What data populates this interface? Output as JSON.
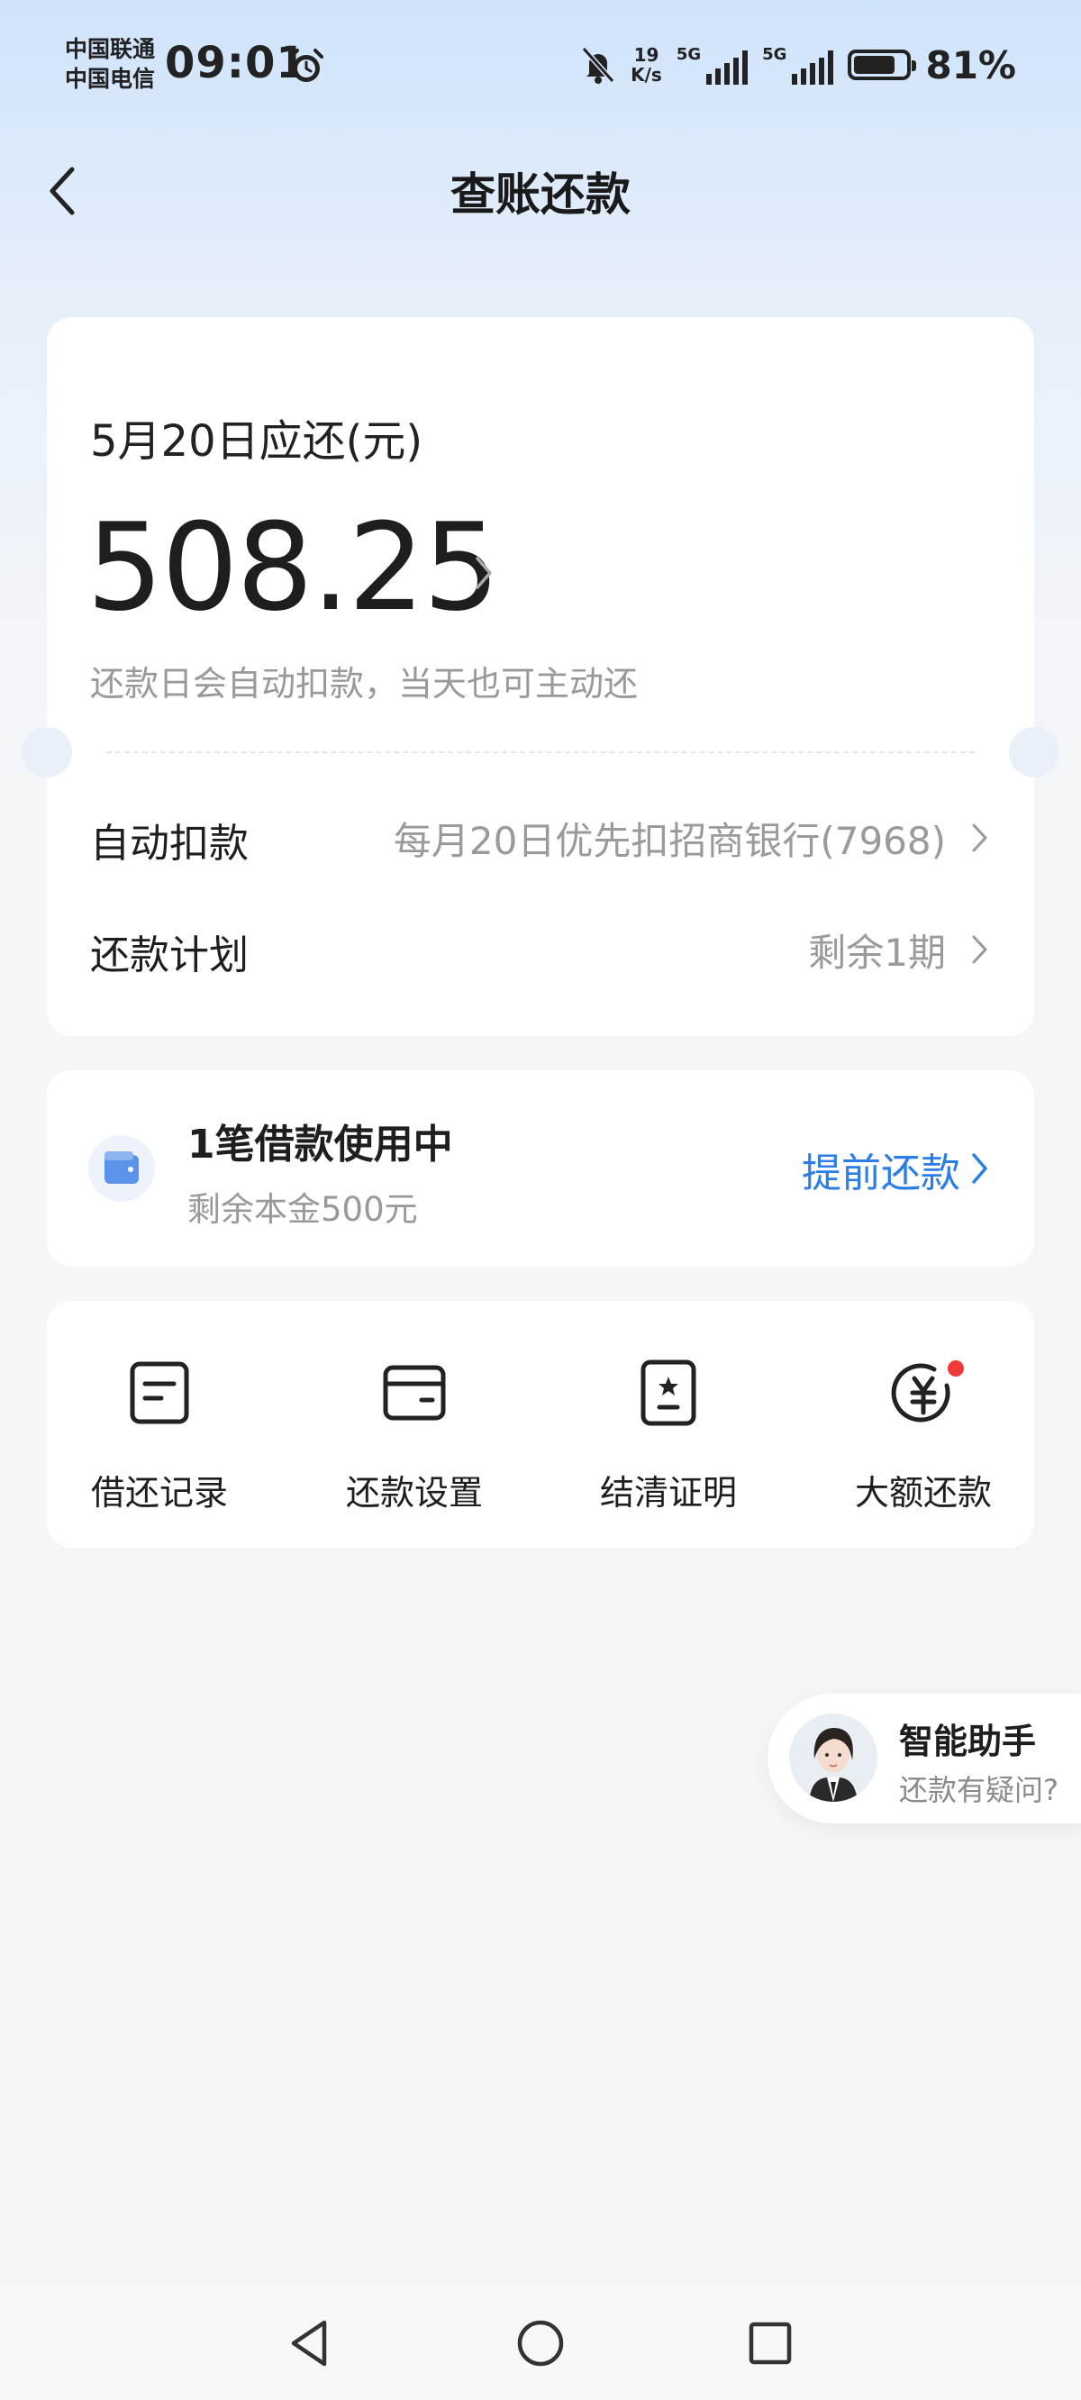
{
  "status_bar": {
    "carrier1": "中国联通",
    "carrier2": "中国电信",
    "time": "09:01",
    "net_speed_value": "19",
    "net_speed_unit": "K/s",
    "signal1": "5G",
    "signal2": "5G",
    "battery_percent": "81%",
    "battery_level": 0.81
  },
  "header": {
    "title": "查账还款"
  },
  "due_card": {
    "label": "5月20日应还(元)",
    "amount": "508.25",
    "note": "还款日会自动扣款，当天也可主动还",
    "rows": [
      {
        "label": "自动扣款",
        "value": "每月20日优先扣招商银行(7968)"
      },
      {
        "label": "还款计划",
        "value": "剩余1期"
      }
    ]
  },
  "loan_card": {
    "title": "1笔借款使用中",
    "subtitle": "剩余本金500元",
    "action": "提前还款"
  },
  "quick_actions": [
    {
      "label": "借还记录",
      "icon": "document-icon"
    },
    {
      "label": "还款设置",
      "icon": "card-icon"
    },
    {
      "label": "结清证明",
      "icon": "certificate-icon"
    },
    {
      "label": "大额还款",
      "icon": "yuan-icon"
    }
  ],
  "assistant": {
    "title": "智能助手",
    "subtitle": "还款有疑问?"
  },
  "colors": {
    "accent": "#2b7de9",
    "badge": "#f03a3a"
  }
}
